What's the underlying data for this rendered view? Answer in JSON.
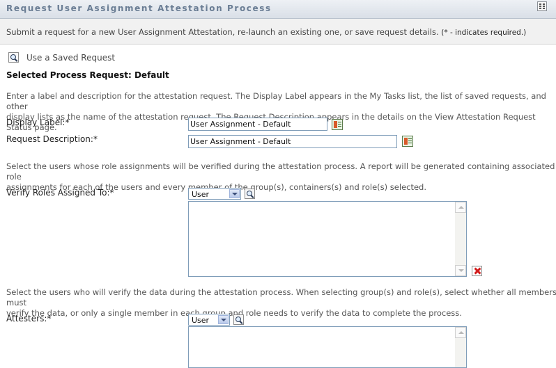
{
  "header": {
    "title": "Request User Assignment Attestation Process"
  },
  "subheader": {
    "text": "Submit a request for a new User Assignment Attestation, re-launch an existing one, or save request details.",
    "required_note": "(* - indicates required.)"
  },
  "saved_request": {
    "link_label": "Use a Saved Request"
  },
  "selected_process": {
    "label": "Selected Process Request: Default"
  },
  "label_section": {
    "description_line1": "Enter a label and description for the attestation request. The Display Label appears in the My Tasks list, the list of saved requests, and other",
    "description_line2": "display lists as the name of the attestation request. The Request Description appears in the details on the View Attestation Request Status page.",
    "display_label": "Display Label:*",
    "display_label_value": "User Assignment - Default",
    "request_description": "Request Description:*",
    "request_description_value": "User Assignment - Default"
  },
  "verify_section": {
    "description_line1": "Select the users whose role assignments will be verified during the attestation process. A report will be generated containing associated role",
    "description_line2": "assignments for each of the users and every member of the group(s), containers(s) and role(s) selected.",
    "label": "Verify Roles Assigned To:*",
    "type_selected": "User"
  },
  "attesters_section": {
    "description_line1": "Select the users who will verify the data during the attestation process. When selecting group(s) and role(s), select whether all members must",
    "description_line2": "verify the data, or only a single member in each group and role needs to verify the data to complete the process.",
    "label": "Attesters:*",
    "type_selected": "User"
  }
}
